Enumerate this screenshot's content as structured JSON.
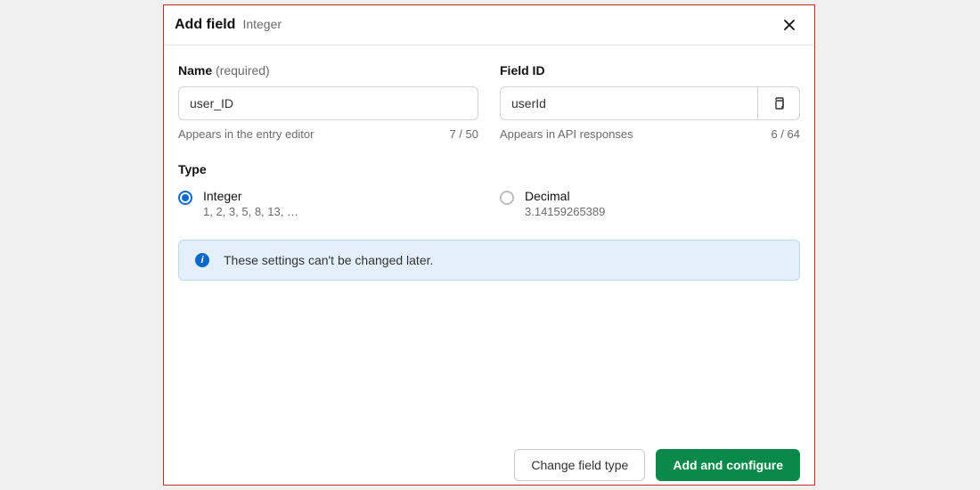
{
  "header": {
    "title": "Add field",
    "subtitle": "Integer"
  },
  "name_field": {
    "label": "Name",
    "annotation": "(required)",
    "value": "user_ID",
    "help": "Appears in the entry editor",
    "count": "7 / 50"
  },
  "id_field": {
    "label": "Field ID",
    "value": "userId",
    "help": "Appears in API responses",
    "count": "6 / 64"
  },
  "type_section": {
    "label": "Type",
    "options": [
      {
        "title": "Integer",
        "desc": "1, 2, 3, 5, 8, 13, …",
        "selected": true
      },
      {
        "title": "Decimal",
        "desc": "3.14159265389",
        "selected": false
      }
    ]
  },
  "banner": {
    "text": "These settings can't be changed later."
  },
  "footer": {
    "secondary": "Change field type",
    "primary": "Add and configure"
  }
}
